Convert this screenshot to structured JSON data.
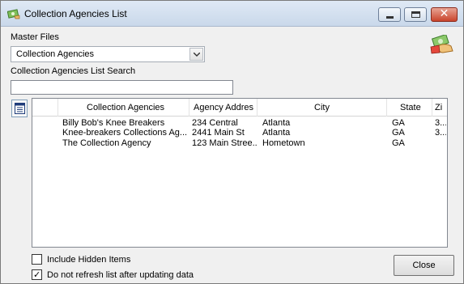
{
  "window": {
    "title": "Collection Agencies List",
    "close_glyph": "✕"
  },
  "master_files": {
    "label": "Master Files",
    "selected": "Collection Agencies"
  },
  "search": {
    "label": "Collection Agencies List Search",
    "value": ""
  },
  "grid": {
    "columns": [
      "Collection Agencies",
      "Agency Addres",
      "City",
      "State",
      "Zi"
    ],
    "rows": [
      [
        "Billy Bob's Knee Breakers",
        "234 Central",
        "Atlanta",
        "GA",
        "3..."
      ],
      [
        "Knee-breakers Collections Ag...",
        "2441 Main St",
        "Atlanta",
        "GA",
        "3..."
      ],
      [
        "The Collection Agency",
        "123 Main Stree...",
        "Hometown",
        "GA",
        ""
      ]
    ]
  },
  "options": {
    "include_hidden": {
      "label": "Include Hidden Items",
      "checked": false
    },
    "no_refresh": {
      "label": "Do not refresh list after updating data",
      "checked": true,
      "mark": "✓"
    }
  },
  "buttons": {
    "close": "Close"
  },
  "colors": {
    "window_bg": "#f0f0f0",
    "title_close": "#c9442c",
    "border": "#828790"
  },
  "icons": {
    "title": "app-icon",
    "list": "list-icon",
    "column_picker": "flashlight-icon",
    "corner": "money-hand-icon"
  }
}
